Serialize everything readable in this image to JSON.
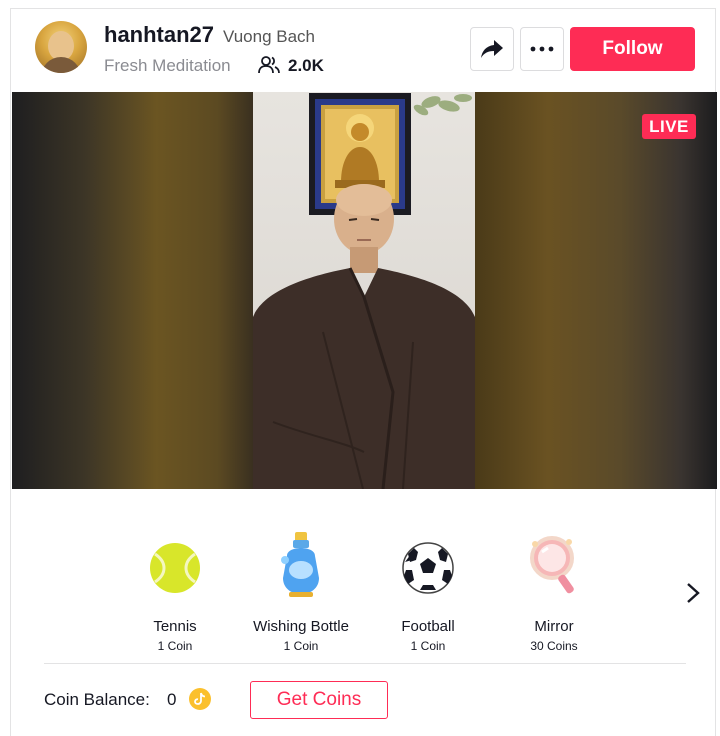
{
  "header": {
    "username": "hanhtan27",
    "nickname": "Vuong Bach",
    "title": "Fresh Meditation",
    "viewer_count": "2.0K",
    "follow_label": "Follow"
  },
  "video": {
    "live_badge": "LIVE"
  },
  "gifts": [
    {
      "name": "Tennis",
      "price": "1 Coin",
      "icon": "tennis-ball-icon"
    },
    {
      "name": "Wishing Bottle",
      "price": "1 Coin",
      "icon": "wishing-bottle-icon"
    },
    {
      "name": "Football",
      "price": "1 Coin",
      "icon": "football-icon"
    },
    {
      "name": "Mirror",
      "price": "30 Coins",
      "icon": "mirror-icon"
    }
  ],
  "wallet": {
    "balance_label": "Coin Balance:",
    "balance_value": "0",
    "get_coins_label": "Get Coins"
  },
  "colors": {
    "accent": "#fe2c55",
    "coin": "#fbc02d"
  }
}
